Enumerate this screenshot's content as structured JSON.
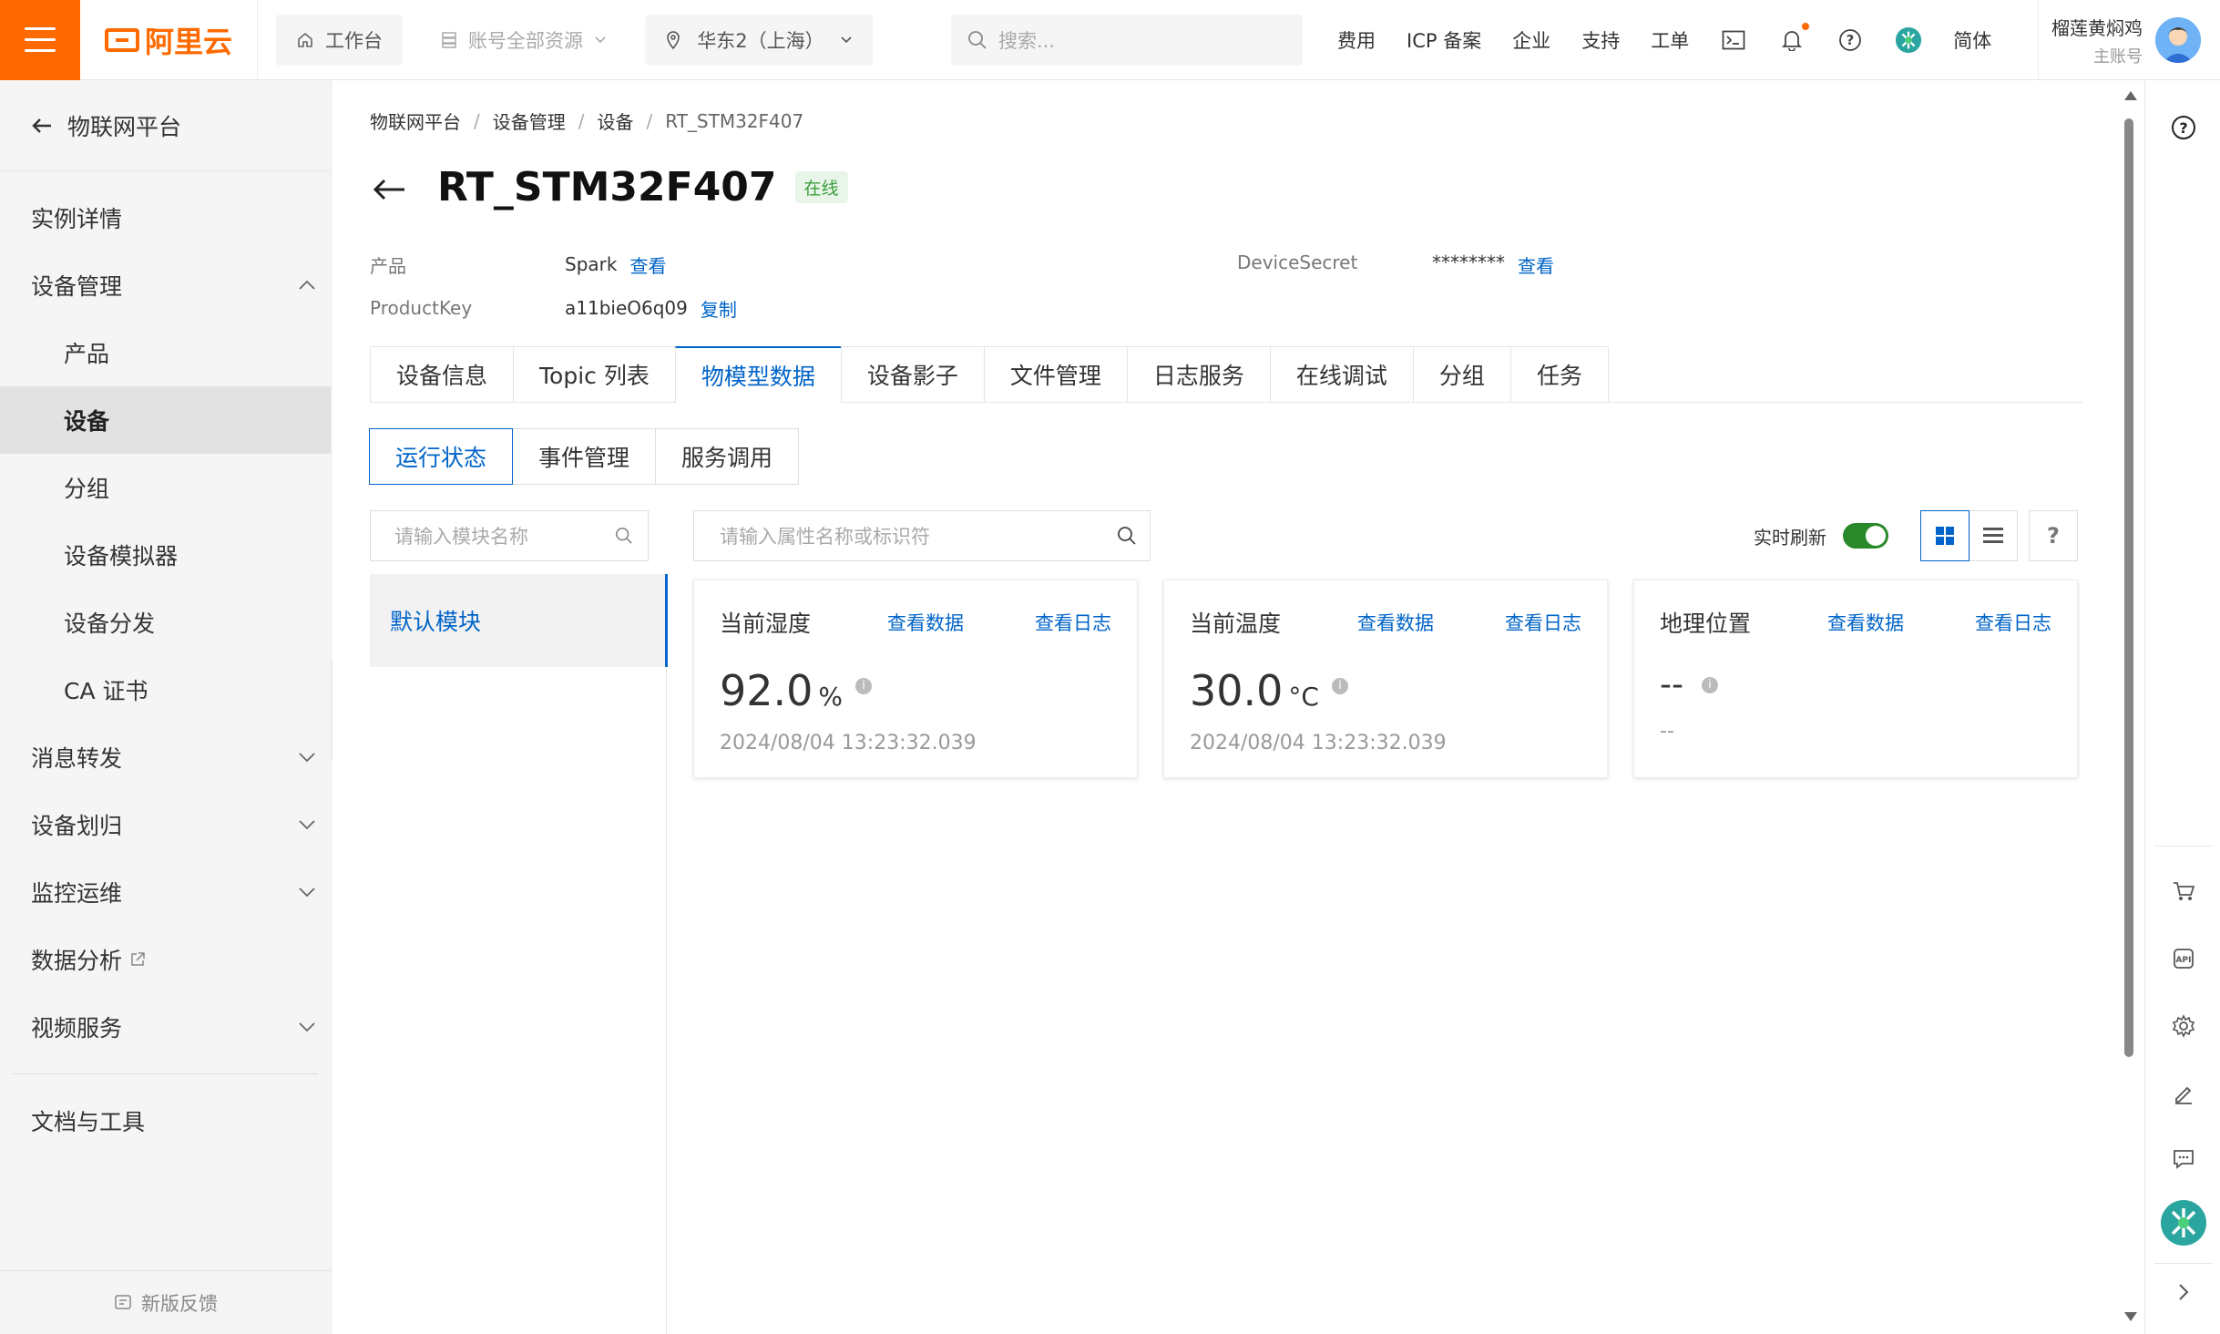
{
  "header": {
    "logo_text": "阿里云",
    "workbench": "工作台",
    "account_resources": "账号全部资源",
    "region": "华东2（上海）",
    "search_placeholder": "搜索...",
    "links": [
      "费用",
      "ICP 备案",
      "企业",
      "支持",
      "工单"
    ],
    "language": "简体",
    "user_name": "榴莲黄焖鸡",
    "user_role": "主账号"
  },
  "sidebar": {
    "back_label": "物联网平台",
    "items": [
      {
        "label": "实例详情"
      },
      {
        "label": "设备管理"
      },
      {
        "label": "产品"
      },
      {
        "label": "设备"
      },
      {
        "label": "分组"
      },
      {
        "label": "设备模拟器"
      },
      {
        "label": "设备分发"
      },
      {
        "label": "CA 证书"
      },
      {
        "label": "消息转发"
      },
      {
        "label": "设备划归"
      },
      {
        "label": "监控运维"
      },
      {
        "label": "数据分析"
      },
      {
        "label": "视频服务"
      },
      {
        "label": "文档与工具"
      }
    ],
    "feedback": "新版反馈"
  },
  "breadcrumb": [
    "物联网平台",
    "设备管理",
    "设备",
    "RT_STM32F407"
  ],
  "device": {
    "name": "RT_STM32F407",
    "status": "在线",
    "product_label": "产品",
    "product_value": "Spark",
    "product_link": "查看",
    "productkey_label": "ProductKey",
    "productkey_value": "a11bieO6q09",
    "productkey_link": "复制",
    "secret_label": "DeviceSecret",
    "secret_value": "********",
    "secret_link": "查看"
  },
  "tabs": [
    "设备信息",
    "Topic 列表",
    "物模型数据",
    "设备影子",
    "文件管理",
    "日志服务",
    "在线调试",
    "分组",
    "任务"
  ],
  "active_tab": "物模型数据",
  "subtabs": [
    "运行状态",
    "事件管理",
    "服务调用"
  ],
  "module_search_placeholder": "请输入模块名称",
  "module_default": "默认模块",
  "prop_search_placeholder": "请输入属性名称或标识符",
  "realtime_refresh_label": "实时刷新",
  "realtime_refresh_on": true,
  "card_link_data": "查看数据",
  "card_link_log": "查看日志",
  "cards": [
    {
      "title": "当前湿度",
      "value": "92.0",
      "unit": "%",
      "time": "2024/08/04 13:23:32.039"
    },
    {
      "title": "当前温度",
      "value": "30.0",
      "unit": "°C",
      "time": "2024/08/04 13:23:32.039"
    },
    {
      "title": "地理位置",
      "value": "--",
      "unit": "",
      "time": "--"
    }
  ],
  "colors": {
    "brand": "#ff6a00",
    "link": "#0064c8",
    "online": "#3b9e3b"
  }
}
